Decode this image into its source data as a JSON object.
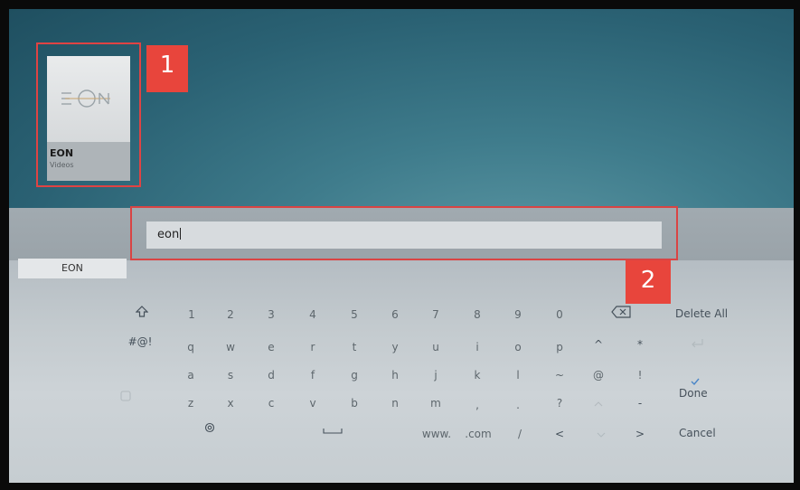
{
  "app": {
    "tile_title": "EON",
    "tile_subtitle": "Videos",
    "badge_1": "1",
    "badge_2": "2"
  },
  "search": {
    "value": "eon",
    "suggestion": "EON"
  },
  "keys": {
    "row1": [
      "1",
      "2",
      "3",
      "4",
      "5",
      "6",
      "7",
      "8",
      "9",
      "0"
    ],
    "row2": [
      "q",
      "w",
      "e",
      "r",
      "t",
      "y",
      "u",
      "i",
      "o",
      "p",
      "^",
      "*"
    ],
    "row3": [
      "a",
      "s",
      "d",
      "f",
      "g",
      "h",
      "j",
      "k",
      "l",
      "~",
      "@",
      "!"
    ],
    "row4": [
      "z",
      "x",
      "c",
      "v",
      "b",
      "n",
      "m",
      ",",
      ".",
      "?",
      "-"
    ],
    "row5_www": "www.",
    "row5_com": ".com",
    "row5_slash": "/",
    "row5_left": "<",
    "row5_right": ">",
    "symbols": "#@!"
  },
  "actions": {
    "delete_all": "Delete All",
    "done": "Done",
    "cancel": "Cancel"
  },
  "icons": {
    "shift": "shift-arrow-icon",
    "backspace": "backspace-x-icon",
    "enter": "enter-icon",
    "settings": "gear-icon",
    "space": "space-bar-icon",
    "done_check": "checkmark-icon"
  }
}
